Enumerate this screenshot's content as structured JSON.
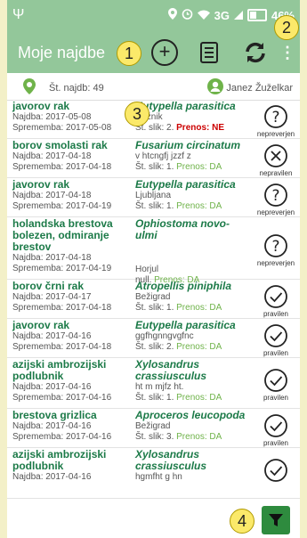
{
  "status_bar": {
    "usb": "Ψ",
    "network": "3G",
    "battery": "46%"
  },
  "app": {
    "title": "Moje najdbe"
  },
  "markers": [
    "1",
    "2",
    "3",
    "4"
  ],
  "info": {
    "count": "Št. najdb: 49",
    "user": "Janez Žuželkar"
  },
  "records": [
    {
      "name": [
        "javorov rak"
      ],
      "latin": [
        "Eutypella parasitica"
      ],
      "found": "Najdba: 2017-05-08",
      "location": "Rožnik",
      "changed": "Sprememba: 2017-05-08",
      "photos": "Št. slik: 2.",
      "transfer": "Prenos: NE",
      "transfer_ok": false,
      "status": "question",
      "status_label": "nepreverjen"
    },
    {
      "name": [
        "borov smolasti rak"
      ],
      "latin": [
        "Fusarium circinatum"
      ],
      "found": "Najdba: 2017-04-18",
      "location": "v htcngfj jzzf z",
      "changed": "Sprememba: 2017-04-18",
      "photos": "Št. slik: 1.",
      "transfer": "Prenos: DA",
      "transfer_ok": true,
      "status": "cross",
      "status_label": "nepravilen"
    },
    {
      "name": [
        "javorov rak"
      ],
      "latin": [
        "Eutypella parasitica"
      ],
      "found": "Najdba: 2017-04-18",
      "location": "Ljubljana",
      "changed": "Sprememba: 2017-04-19",
      "photos": "Št. slik: 1.",
      "transfer": "Prenos: DA",
      "transfer_ok": true,
      "status": "question",
      "status_label": "nepreverjen"
    },
    {
      "name": [
        "holandska brestova",
        "bolezen, odmiranje",
        "brestov"
      ],
      "latin": [
        "Ophiostoma novo-ulmi"
      ],
      "found": "Najdba: 2017-04-18",
      "location": "Horjul",
      "changed": "Sprememba: 2017-04-19",
      "photos": "null.",
      "transfer": "Prenos: DA",
      "transfer_ok": true,
      "status": "question",
      "status_label": "nepreverjen"
    },
    {
      "name": [
        "borov črni rak"
      ],
      "latin": [
        "Atropellis piniphila"
      ],
      "found": "Najdba: 2017-04-17",
      "location": "Bežigrad",
      "changed": "Sprememba: 2017-04-18",
      "photos": "Št. slik: 1.",
      "transfer": "Prenos: DA",
      "transfer_ok": true,
      "status": "check",
      "status_label": "pravilen"
    },
    {
      "name": [
        "javorov rak"
      ],
      "latin": [
        "Eutypella parasitica"
      ],
      "found": "Najdba: 2017-04-16",
      "location": "ggfhgnngvgfnc",
      "changed": "Sprememba: 2017-04-18",
      "photos": "Št. slik: 2.",
      "transfer": "Prenos: DA",
      "transfer_ok": true,
      "status": "check",
      "status_label": "pravilen"
    },
    {
      "name": [
        "azijski ambrozijski",
        "podlubnik"
      ],
      "latin": [
        "Xylosandrus",
        "crassiusculus"
      ],
      "found": "Najdba: 2017-04-16",
      "location": "ht m mjfz ht.",
      "changed": "Sprememba: 2017-04-16",
      "photos": "Št. slik: 1.",
      "transfer": "Prenos: DA",
      "transfer_ok": true,
      "status": "check",
      "status_label": "pravilen"
    },
    {
      "name": [
        "brestova grizlica"
      ],
      "latin": [
        "Aproceros leucopoda"
      ],
      "found": "Najdba: 2017-04-16",
      "location": "Bežigrad",
      "changed": "Sprememba: 2017-04-16",
      "photos": "Št. slik: 3.",
      "transfer": "Prenos: DA",
      "transfer_ok": true,
      "status": "check",
      "status_label": "pravilen"
    },
    {
      "name": [
        "azijski ambrozijski",
        "podlubnik"
      ],
      "latin": [
        "Xylosandrus",
        "crassiusculus"
      ],
      "found": "Najdba: 2017-04-16",
      "location": "hgmfht g hn",
      "changed": "",
      "photos": "",
      "transfer": "",
      "transfer_ok": true,
      "status": "check",
      "status_label": ""
    }
  ]
}
